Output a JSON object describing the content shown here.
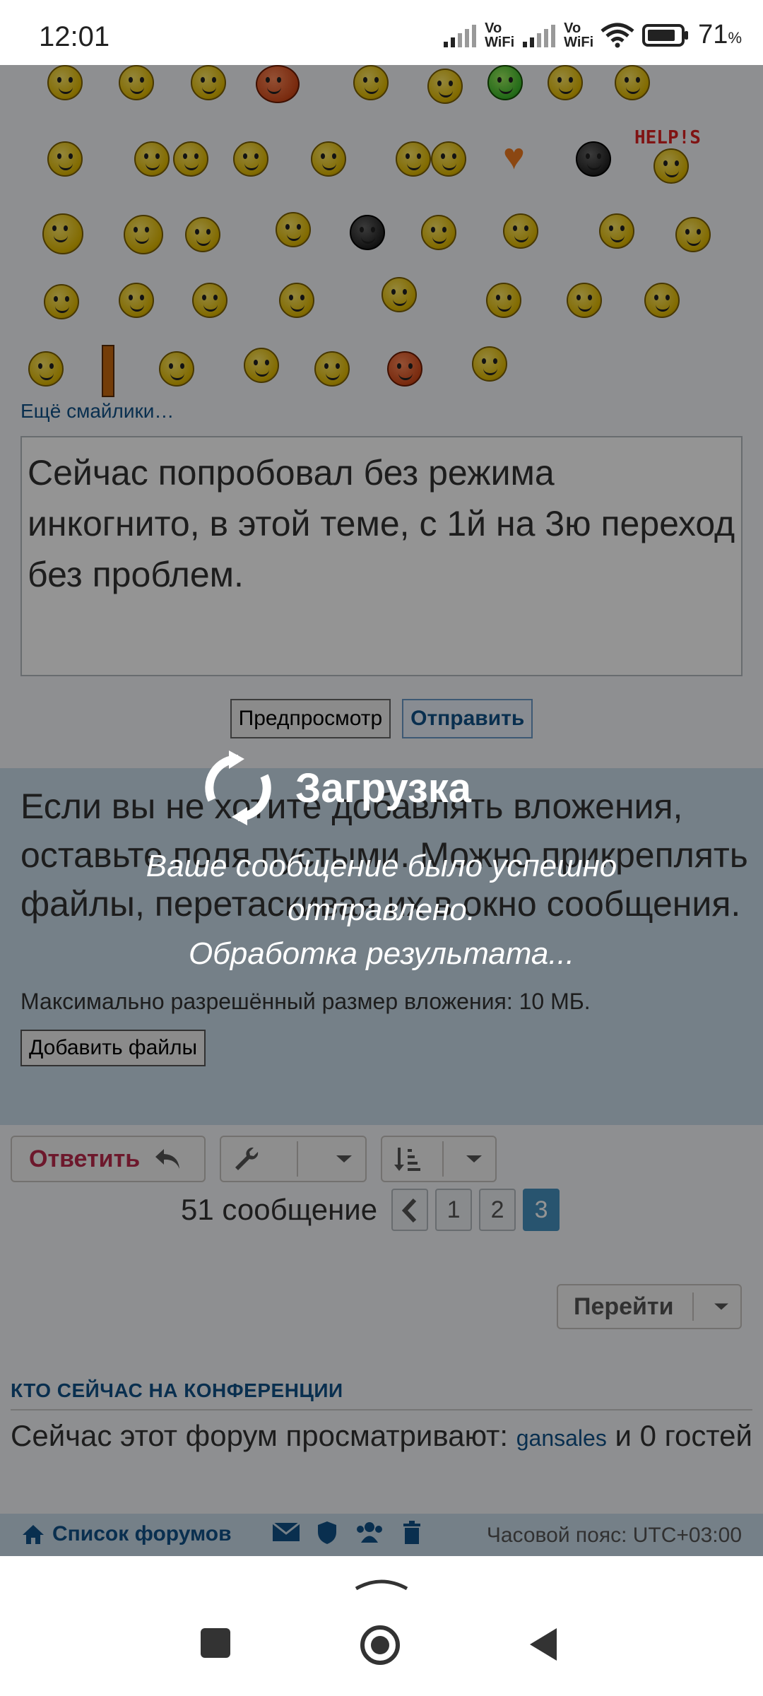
{
  "status_bar": {
    "time": "12:01",
    "vowifi_1": "Vo\nWiFi",
    "vowifi_2": "Vo\nWiFi",
    "battery": "71",
    "battery_unit": "%"
  },
  "editor": {
    "more_smileys_link": "Ещё смайлики…",
    "message_text": "Сейчас попробовал без режима инкогнито, в этой теме, с 1й на 3ю переход без проблем.",
    "preview_button": "Предпросмотр",
    "submit_button": "Отправить"
  },
  "attachments": {
    "info_text": "Если вы не хотите добавлять вложения, оставьте поля пустыми. Можно прикреплять файлы, перетаскивая их в окно сообщения.",
    "max_size_text": "Максимально разрешённый размер вложения: 10 МБ.",
    "add_files_button": "Добавить файлы"
  },
  "topic_actions": {
    "reply_button": "Ответить",
    "message_count": "51 сообщение",
    "pages": [
      "1",
      "2",
      "3"
    ],
    "active_page": "3",
    "goto_button": "Перейти"
  },
  "who_is_online": {
    "title": "КТО СЕЙЧАС НА КОНФЕРЕНЦИИ",
    "text_before": "Сейчас этот форум просматривают: ",
    "user": "gansales",
    "text_after": " и 0 гостей"
  },
  "footer": {
    "forum_list_link": "Список форумов",
    "timezone": "Часовой пояс: UTC+03:00"
  },
  "loading_popup": {
    "title": "Загрузка",
    "message_line1": "Ваше сообщение было успешно отправлено.",
    "message_line2": "Обработка результата..."
  },
  "colors": {
    "link": "#105289",
    "reply": "#bc2a4d",
    "active_page": "#4692bf",
    "panel": "#cadceb"
  }
}
